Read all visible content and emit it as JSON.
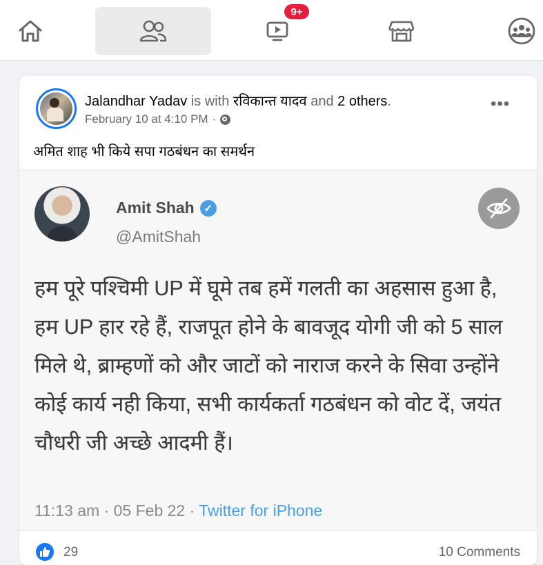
{
  "nav": {
    "items": [
      {
        "name": "home-icon",
        "active": false
      },
      {
        "name": "friends-icon",
        "active": true
      },
      {
        "name": "watch-icon",
        "active": false
      },
      {
        "name": "marketplace-icon",
        "active": false
      },
      {
        "name": "groups-icon",
        "active": false
      }
    ],
    "watch_badge": "9+"
  },
  "post": {
    "author": "Jalandhar Yadav",
    "with_text": "is with",
    "tagged": "रविकान्त यादव",
    "and_text": "and",
    "others": "2 others",
    "period": ".",
    "timestamp": "February 10 at 4:10 PM",
    "separator": "·",
    "privacy_icon": "globe-icon",
    "caption": "अमित  शाह  भी किये सपा गठबंधन  का समर्थन",
    "more_icon": "more-horizontal-icon",
    "reactions_count": "29",
    "comments": "10 Comments"
  },
  "tweet": {
    "name": "Amit Shah",
    "handle": "@AmitShah",
    "text": "हम पूरे पश्चिमी UP में घूमे तब हमें गलती का अहसास हुआ है, हम UP हार रहे हैं, राजपूत होने के बावजूद योगी जी को 5 साल मिले थे, ब्राम्हणों को और जाटों को नाराज करने के सिवा उन्होंने कोई कार्य नही किया, सभी कार्यकर्ता गठबंधन को वोट दें, जयंत चौधरी जी अच्छे आदमी हैं।",
    "time": "11:13 am · 05 Feb 22 · ",
    "source": "Twitter for iPhone"
  },
  "colors": {
    "brand": "#1877f2",
    "badge": "#e41e3f",
    "twitter": "#4a9fe0"
  }
}
